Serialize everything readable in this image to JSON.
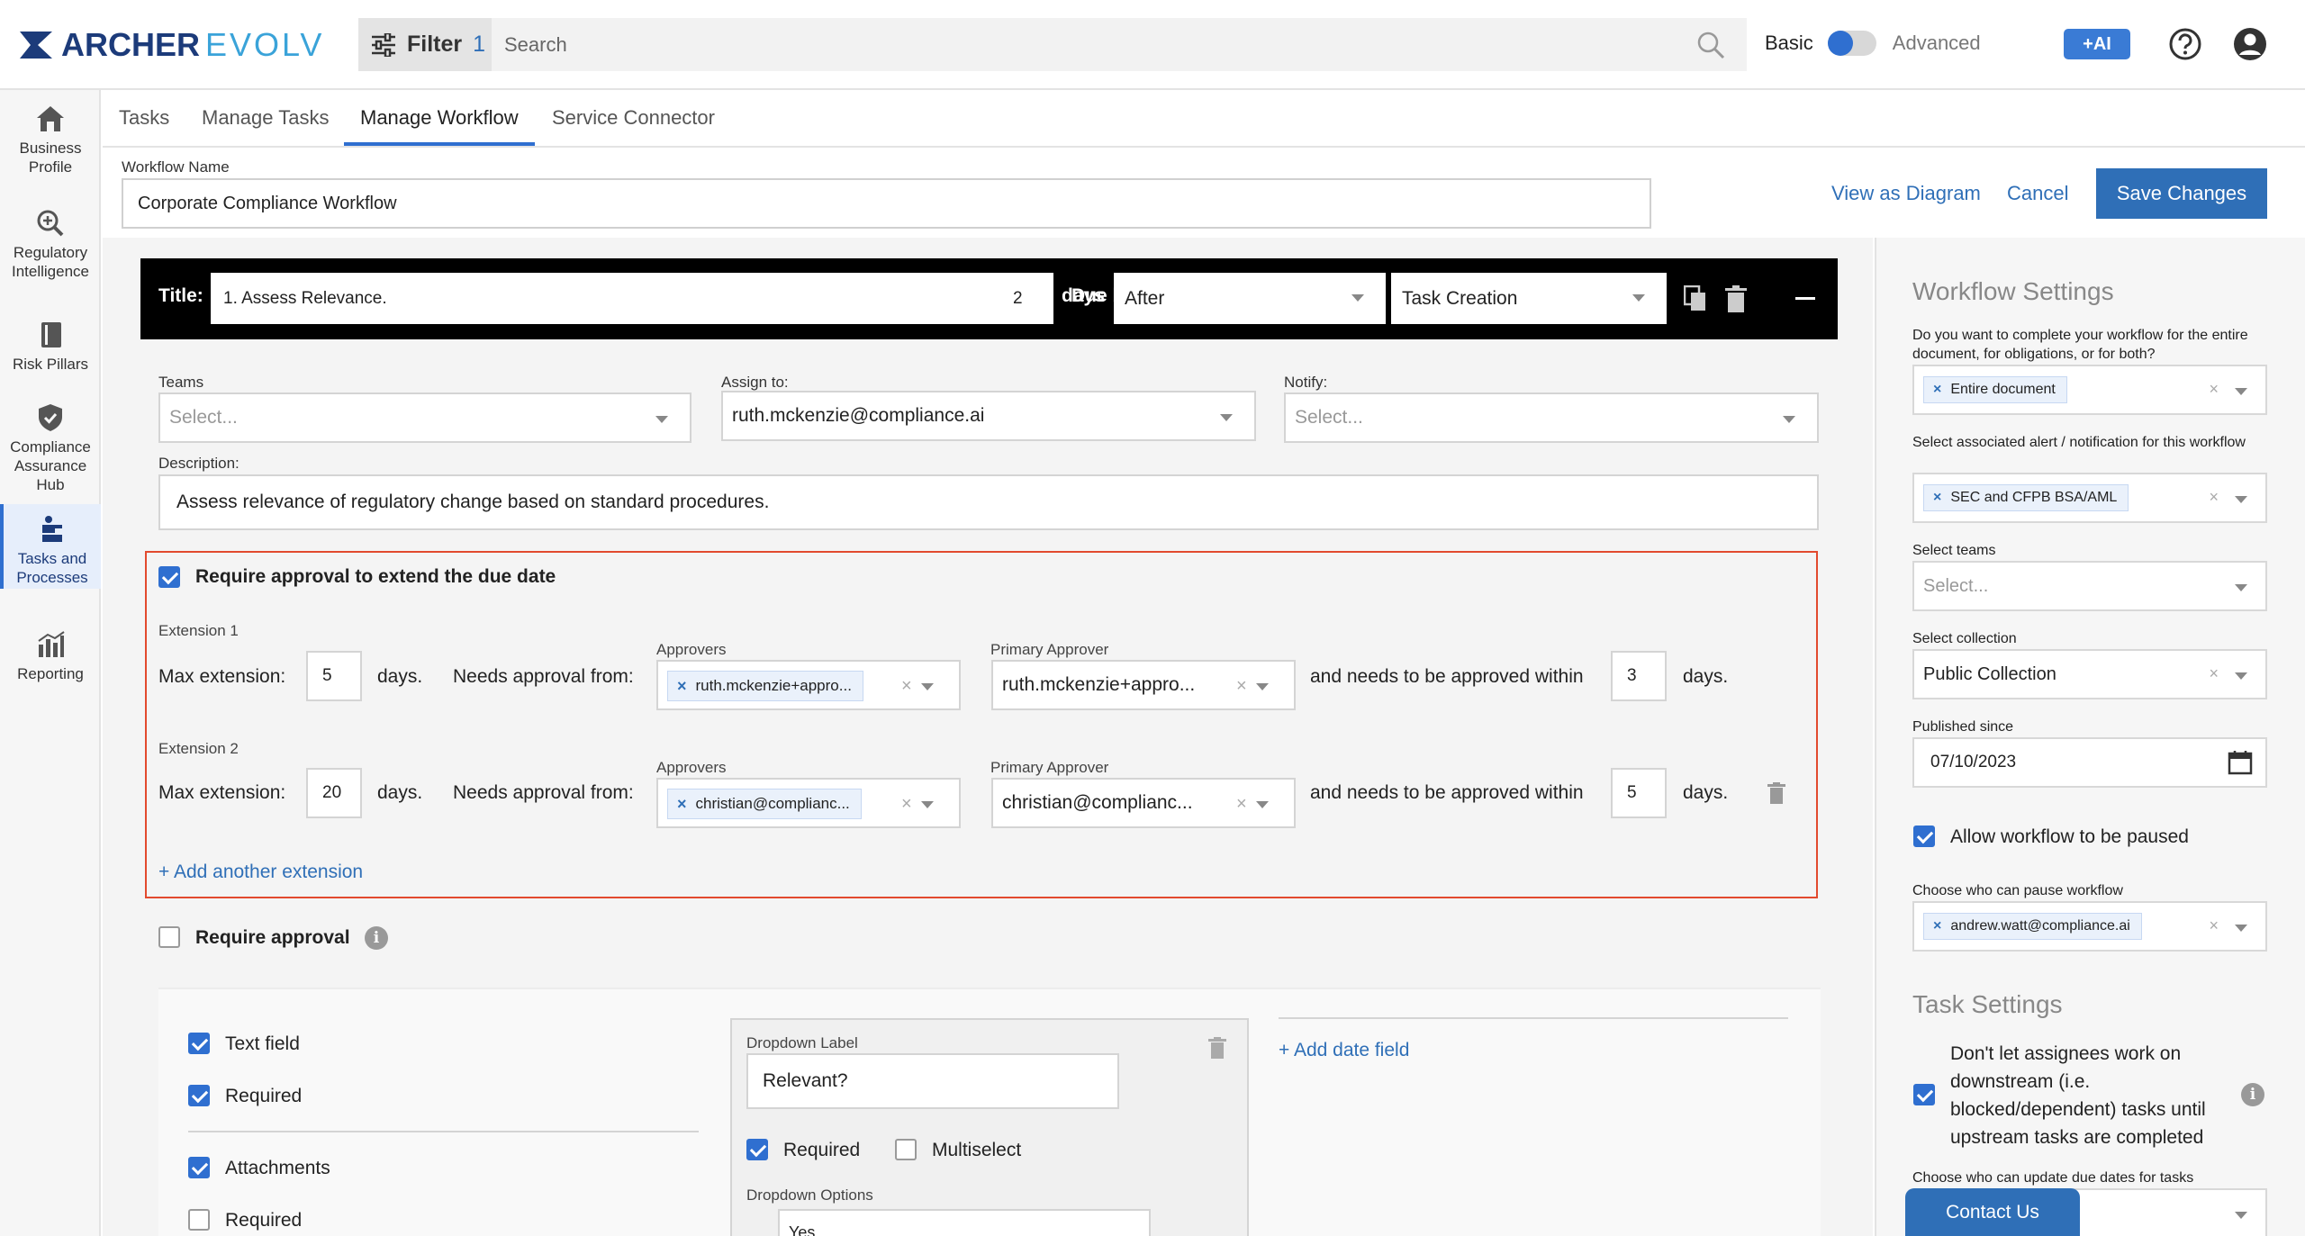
{
  "header": {
    "logo_primary": "ARCHER",
    "logo_secondary": "EVOLV",
    "filter_label": "Filter",
    "filter_count": "1",
    "search_placeholder": "Search",
    "mode_basic": "Basic",
    "mode_advanced": "Advanced",
    "ai_label": "+AI"
  },
  "sidebar": {
    "items": [
      {
        "label": "Business Profile",
        "icon": "house-icon"
      },
      {
        "label": "Regulatory Intelligence",
        "icon": "magnifier-plus-icon"
      },
      {
        "label": "Risk Pillars",
        "icon": "book-icon"
      },
      {
        "label": "Compliance Assurance Hub",
        "icon": "shield-check-icon"
      },
      {
        "label": "Tasks and Processes",
        "icon": "tasks-icon"
      },
      {
        "label": "Reporting",
        "icon": "bar-chart-icon"
      }
    ]
  },
  "tabs": [
    "Tasks",
    "Manage Tasks",
    "Manage Workflow",
    "Service Connector"
  ],
  "workflow": {
    "name_label": "Workflow Name",
    "name_value": "Corporate Compliance Workflow",
    "view_diagram": "View as Diagram",
    "cancel": "Cancel",
    "save": "Save Changes"
  },
  "task": {
    "title_label": "Title:",
    "title_value": "1. Assess Relevance.",
    "due_label": "Due by:",
    "due_value": "2",
    "days_label": "days",
    "relation": "After",
    "event": "Task Creation",
    "teams_label": "Teams",
    "teams_placeholder": "Select...",
    "assign_label": "Assign to:",
    "assign_value": "ruth.mckenzie@compliance.ai",
    "notify_label": "Notify:",
    "notify_placeholder": "Select...",
    "description_label": "Description:",
    "description_value": "Assess relevance of regulatory change based on standard procedures."
  },
  "extension": {
    "require_label": "Require approval to extend the due date",
    "max_label": "Max extension:",
    "days": "days.",
    "needs_label": "Needs approval from:",
    "approvers_label": "Approvers",
    "primary_label": "Primary Approver",
    "within_label": "and needs to be approved within",
    "items": [
      {
        "title": "Extension 1",
        "max": "5",
        "approver": "ruth.mckenzie+appro...",
        "primary": "ruth.mckenzie+appro...",
        "within": "3"
      },
      {
        "title": "Extension 2",
        "max": "20",
        "approver": "christian@complianc...",
        "primary": "christian@complianc...",
        "within": "5"
      }
    ],
    "add_label": "+ Add another extension"
  },
  "require_approval_label": "Require approval",
  "fields": {
    "text_field": "Text field",
    "required": "Required",
    "attachments": "Attachments",
    "dropdown_label_title": "Dropdown Label",
    "dropdown_label_value": "Relevant?",
    "multiselect": "Multiselect",
    "dropdown_options": "Dropdown Options",
    "dropdown_option_1": "Yes",
    "add_date_field": "+ Add date field"
  },
  "settings": {
    "workflow_heading": "Workflow Settings",
    "q_complete": "Do you want to complete your workflow for the entire document, for obligations, or for both?",
    "complete_value": "Entire document",
    "q_alert": "Select associated alert / notification for this workflow",
    "alert_value": "SEC and CFPB BSA/AML",
    "q_teams": "Select teams",
    "teams_placeholder": "Select...",
    "q_collection": "Select collection",
    "collection_value": "Public Collection",
    "q_published": "Published since",
    "published_value": "07/10/2023",
    "allow_pause": "Allow workflow to be paused",
    "q_pause_who": "Choose who can pause workflow",
    "pause_value": "andrew.watt@compliance.ai",
    "task_heading": "Task Settings",
    "downstream": "Don't let assignees work on downstream (i.e. blocked/dependent) tasks until upstream tasks are completed",
    "q_due_update": "Choose who can update due dates for tasks"
  },
  "contact": "Contact Us",
  "colors": {
    "accent": "#2f6fb7",
    "highlight_border": "#e24a2e",
    "task_bar": "#000000"
  }
}
